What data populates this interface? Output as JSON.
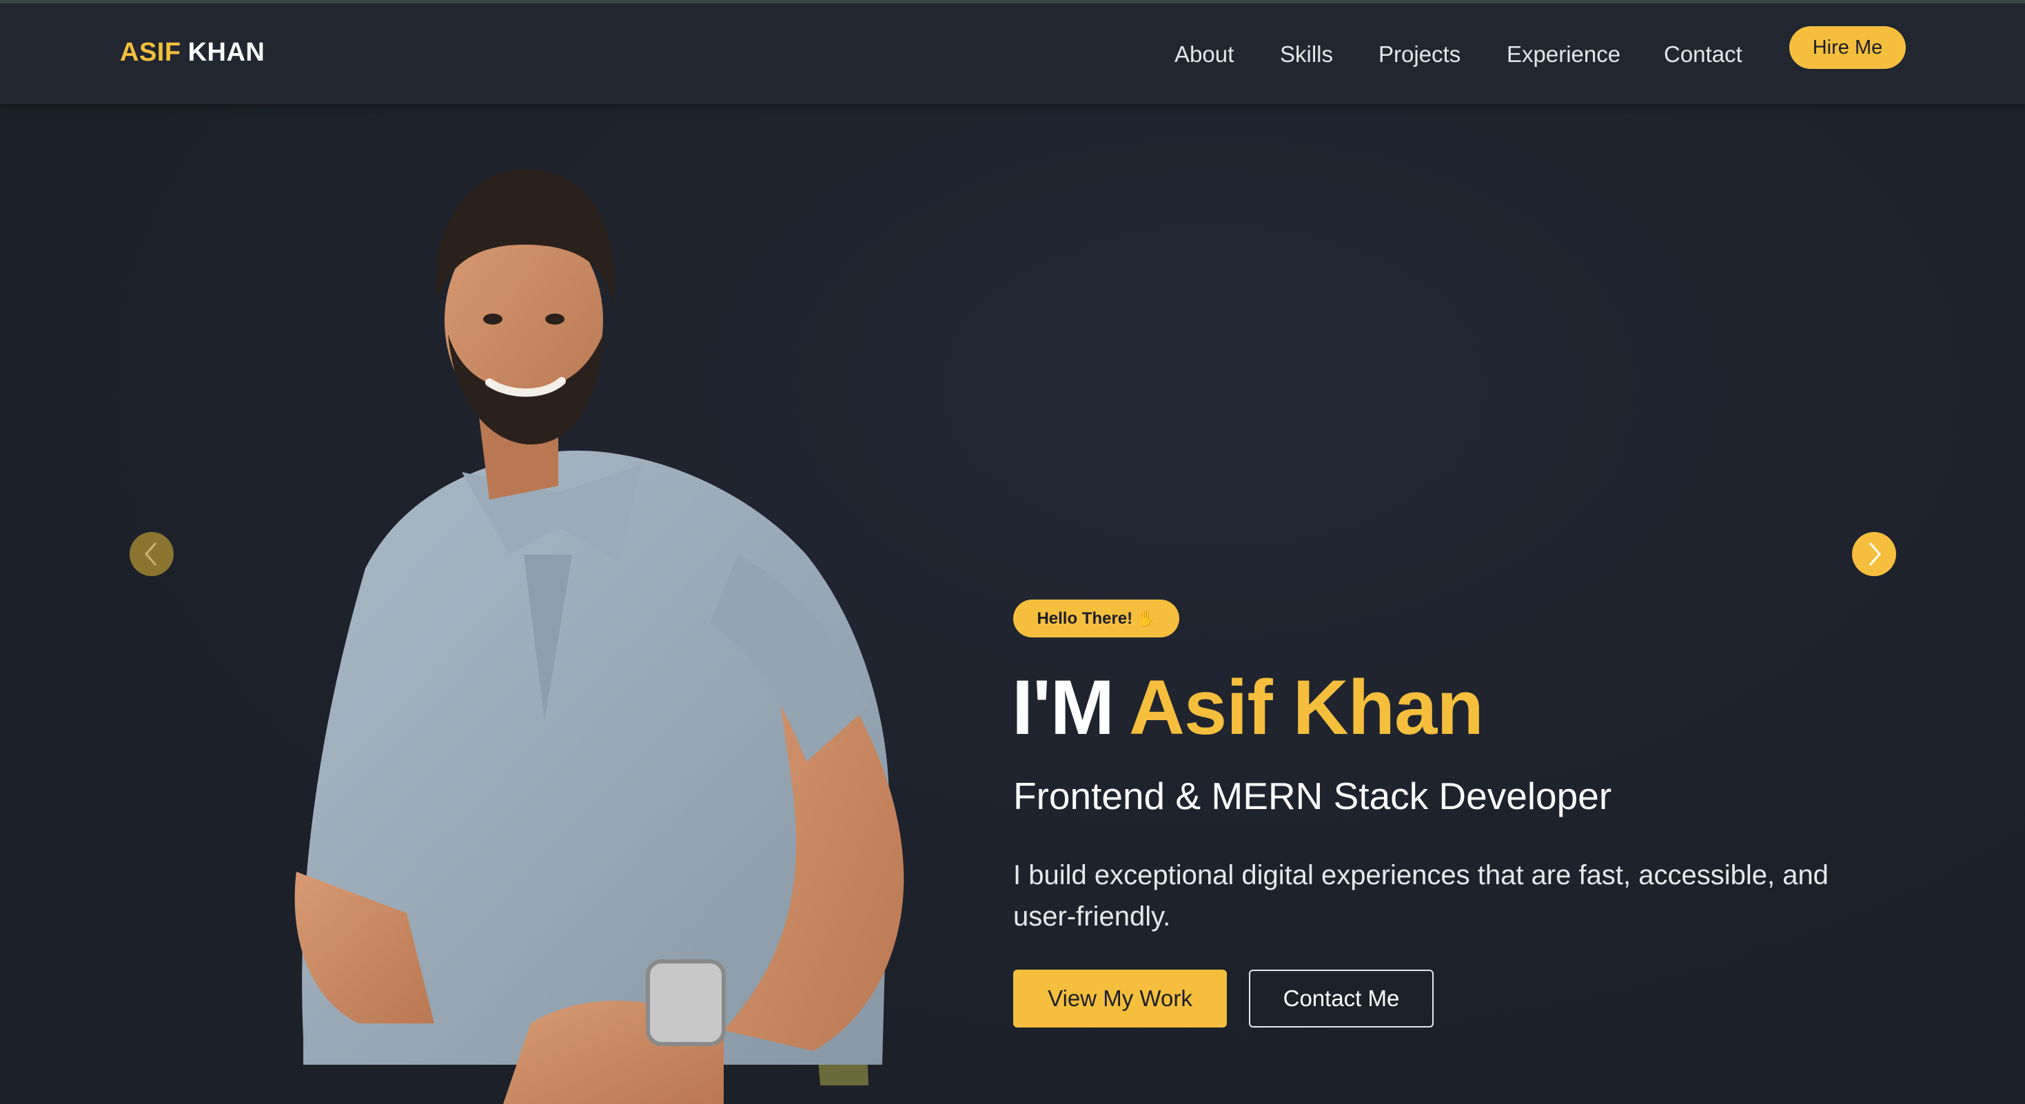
{
  "header": {
    "logo_first": "ASIF",
    "logo_last": "KHAN",
    "nav": [
      "About",
      "Skills",
      "Projects",
      "Experience",
      "Contact"
    ],
    "cta": "Hire Me"
  },
  "hero": {
    "badge_text": "Hello There!",
    "badge_icon": "waving-hand-icon",
    "headline_prefix": "I'M",
    "headline_name": "Asif Khan",
    "subtitle": "Frontend & MERN Stack Developer",
    "description": "I build exceptional digital experiences that are fast, accessible, and user-friendly.",
    "primary_button": "View My Work",
    "secondary_button": "Contact Me"
  },
  "carousel": {
    "prev_icon": "chevron-left-icon",
    "next_icon": "chevron-right-icon"
  },
  "colors": {
    "accent": "#f5bf3d",
    "background": "#1e222c",
    "header_bg": "#212630",
    "text": "#ffffff"
  }
}
